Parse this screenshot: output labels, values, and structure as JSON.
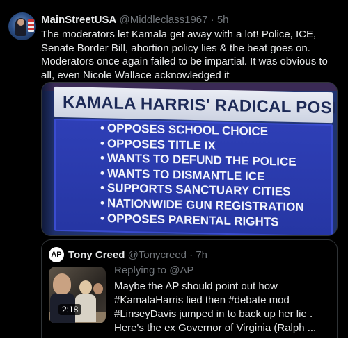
{
  "tweet": {
    "display_name": "MainStreetUSA",
    "handle_time": "@Middleclass1967 · 5h",
    "text": "The moderators let Kamala get away with a lot! Police, ICE, Senate Border Bill, abortion policy  lies & the beat goes on. Moderators once again failed to be impartial. It was obvious to all, even Nicole Wallace acknowledged it"
  },
  "media": {
    "title": "KAMALA HARRIS' RADICAL POSITIONS",
    "items": [
      "Opposes school choice",
      "Opposes Title IX",
      "Wants to defund the police",
      "Wants to dismantle ICE",
      "Supports sanctuary cities",
      "Nationwide gun registration",
      "Opposes parental rights"
    ]
  },
  "quote": {
    "logo": "AP",
    "display_name": "Tony Creed",
    "handle_time": "@Tonycreed · 7h",
    "replying_to": "Replying to @AP",
    "video_duration": "2:18",
    "lines": [
      "Maybe the AP should point out how",
      "#KamalaHarris lied then #debate mod",
      "#LinseyDavis jumped in to back up her lie .",
      "Here's the ex Governor of Virginia (Ralph ..."
    ]
  }
}
